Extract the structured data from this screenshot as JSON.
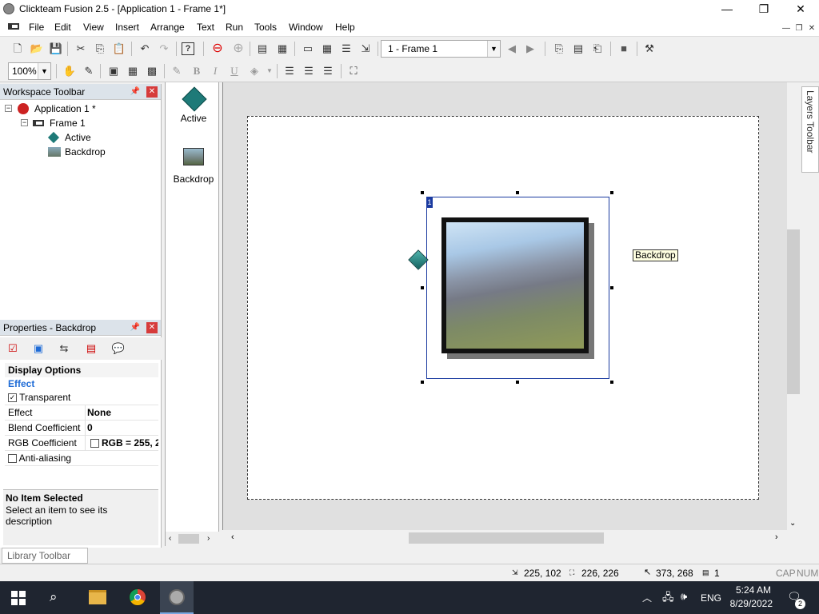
{
  "window": {
    "title": "Clickteam Fusion 2.5 - [Application 1 - Frame 1*]",
    "minimize": "—",
    "maximize": "❐",
    "close": "✕"
  },
  "menu": [
    "File",
    "Edit",
    "View",
    "Insert",
    "Arrange",
    "Text",
    "Run",
    "Tools",
    "Window",
    "Help"
  ],
  "toolbar": {
    "frame_select": "1 - Frame 1",
    "zoom": "100%",
    "bold": "B",
    "italic": "I",
    "underline": "U"
  },
  "workspace": {
    "title": "Workspace Toolbar",
    "app": "Application 1 *",
    "frame": "Frame 1",
    "items": [
      "Active",
      "Backdrop"
    ]
  },
  "objects": [
    {
      "label": "Active",
      "icon": "diamond-icon"
    },
    {
      "label": "Backdrop",
      "icon": "picture-icon"
    }
  ],
  "properties": {
    "title": "Properties - Backdrop",
    "section": "Display Options",
    "group": "Effect",
    "transparent_label": "Transparent",
    "transparent_checked": "✓",
    "rows": [
      {
        "key": "Effect",
        "value": "None"
      },
      {
        "key": "Blend Coefficient",
        "value": "0"
      },
      {
        "key": "RGB Coefficient",
        "value": "RGB = 255, 2"
      }
    ],
    "antialias_label": "Anti-aliasing",
    "desc_title": "No Item Selected",
    "desc_text": "Select an item to see its description"
  },
  "frame": {
    "selection_index": "1",
    "tooltip": "Backdrop"
  },
  "layers_toolbar": "Layers Toolbar",
  "library_toolbar": "Library Toolbar",
  "status": {
    "pos1": "225, 102",
    "pos2": "226, 226",
    "pos3": "373, 268",
    "count": "1",
    "caps": "CAP",
    "num": "NUM"
  },
  "taskbar": {
    "lang": "ENG",
    "time": "5:24 AM",
    "date": "8/29/2022",
    "notif": "2"
  },
  "colors": {
    "accent": "#1e6bd6",
    "titlebar": "#ffffff",
    "taskbar": "#1f2530"
  }
}
